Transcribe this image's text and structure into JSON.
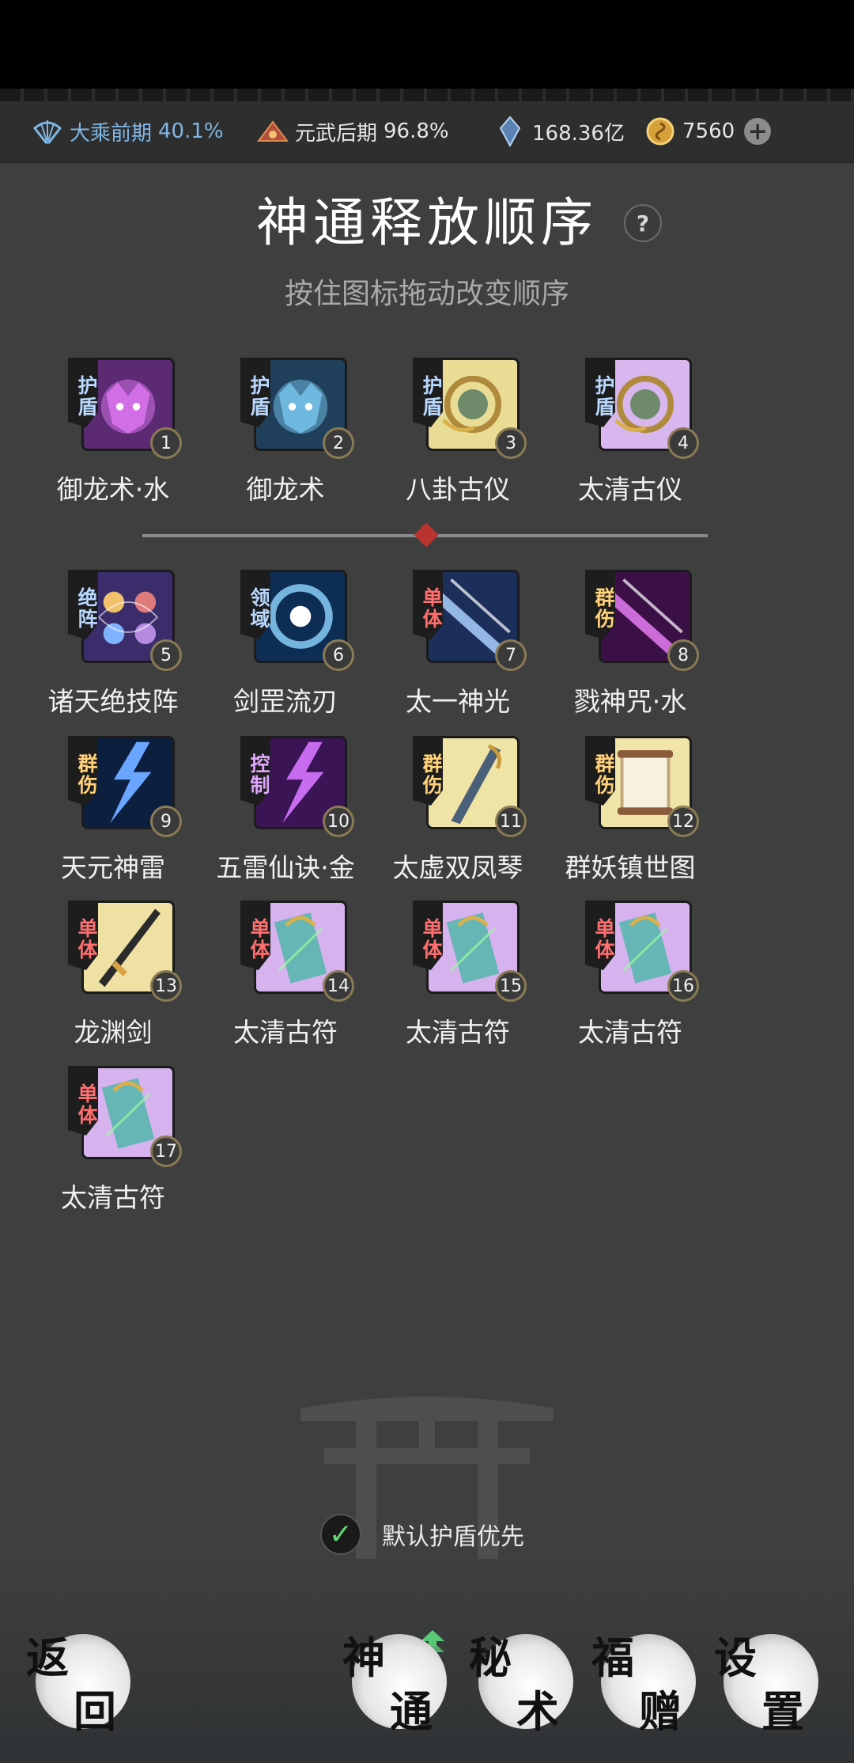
{
  "status": {
    "realm": {
      "label": "大乘前期",
      "percent": "40.1%",
      "icon": "fan-icon"
    },
    "martial": {
      "label": "元武后期",
      "percent": "96.8%",
      "icon": "mountain-icon"
    },
    "spirit_stones": {
      "value": "168.36亿",
      "icon": "crystal-icon"
    },
    "coins": {
      "value": "7560",
      "icon": "coin-icon"
    }
  },
  "page": {
    "title": "神通释放顺序",
    "help": "?",
    "subtitle": "按住图标拖动改变顺序"
  },
  "skills": [
    {
      "num": "1",
      "name": "御龙术·水",
      "tag": "护盾",
      "tag_color": "blue"
    },
    {
      "num": "2",
      "name": "御龙术",
      "tag": "护盾",
      "tag_color": "blue"
    },
    {
      "num": "3",
      "name": "八卦古仪",
      "tag": "护盾",
      "tag_color": "blue"
    },
    {
      "num": "4",
      "name": "太清古仪",
      "tag": "护盾",
      "tag_color": "blue"
    },
    {
      "num": "5",
      "name": "诸天绝技阵",
      "tag": "绝阵",
      "tag_color": "blue"
    },
    {
      "num": "6",
      "name": "剑罡流刃",
      "tag": "领域",
      "tag_color": "blue"
    },
    {
      "num": "7",
      "name": "太一神光",
      "tag": "单体",
      "tag_color": "red"
    },
    {
      "num": "8",
      "name": "戮神咒·水",
      "tag": "群伤",
      "tag_color": "gold"
    },
    {
      "num": "9",
      "name": "天元神雷",
      "tag": "群伤",
      "tag_color": "gold"
    },
    {
      "num": "10",
      "name": "五雷仙诀·金",
      "tag": "控制",
      "tag_color": "purple"
    },
    {
      "num": "11",
      "name": "太虚双凤琴",
      "tag": "群伤",
      "tag_color": "gold"
    },
    {
      "num": "12",
      "name": "群妖镇世图",
      "tag": "群伤",
      "tag_color": "gold"
    },
    {
      "num": "13",
      "name": "龙渊剑",
      "tag": "单体",
      "tag_color": "red"
    },
    {
      "num": "14",
      "name": "太清古符",
      "tag": "单体",
      "tag_color": "red"
    },
    {
      "num": "15",
      "name": "太清古符",
      "tag": "单体",
      "tag_color": "red"
    },
    {
      "num": "16",
      "name": "太清古符",
      "tag": "单体",
      "tag_color": "red"
    },
    {
      "num": "17",
      "name": "太清古符",
      "tag": "单体",
      "tag_color": "red"
    }
  ],
  "options": {
    "shield_first_label": "默认护盾优先",
    "shield_first_checked": true
  },
  "nav": {
    "back": "返回",
    "tabs": [
      {
        "label": "神通",
        "active": true
      },
      {
        "label": "秘术",
        "active": false
      },
      {
        "label": "福赠",
        "active": false
      },
      {
        "label": "设置",
        "active": false
      }
    ]
  }
}
